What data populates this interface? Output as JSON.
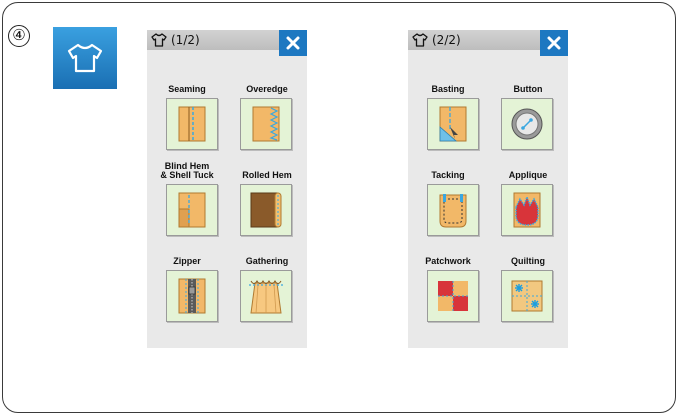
{
  "step": "④",
  "panels": [
    {
      "title": "(1/2)",
      "tiles": [
        {
          "label": "Seaming",
          "icon": "seaming-icon"
        },
        {
          "label": "Overedge",
          "icon": "overedge-icon"
        },
        {
          "label": "Blind Hem\n& Shell Tuck",
          "icon": "blind-hem-icon"
        },
        {
          "label": "Rolled Hem",
          "icon": "rolled-hem-icon"
        },
        {
          "label": "Zipper",
          "icon": "zipper-icon"
        },
        {
          "label": "Gathering",
          "icon": "gathering-icon"
        }
      ]
    },
    {
      "title": "(2/2)",
      "tiles": [
        {
          "label": "Basting",
          "icon": "basting-icon"
        },
        {
          "label": "Button",
          "icon": "button-icon"
        },
        {
          "label": "Tacking",
          "icon": "tacking-icon"
        },
        {
          "label": "Applique",
          "icon": "applique-icon"
        },
        {
          "label": "Patchwork",
          "icon": "patchwork-icon"
        },
        {
          "label": "Quilting",
          "icon": "quilting-icon"
        }
      ]
    }
  ],
  "icons": {
    "app": "shirt-icon",
    "header": "shirt-outline-icon",
    "close": "close-icon"
  },
  "colors": {
    "accent": "#1d78c1",
    "tile_bg": "#e4f3d6",
    "fabric": "#f2b868",
    "stitch": "#3aa7e0"
  }
}
